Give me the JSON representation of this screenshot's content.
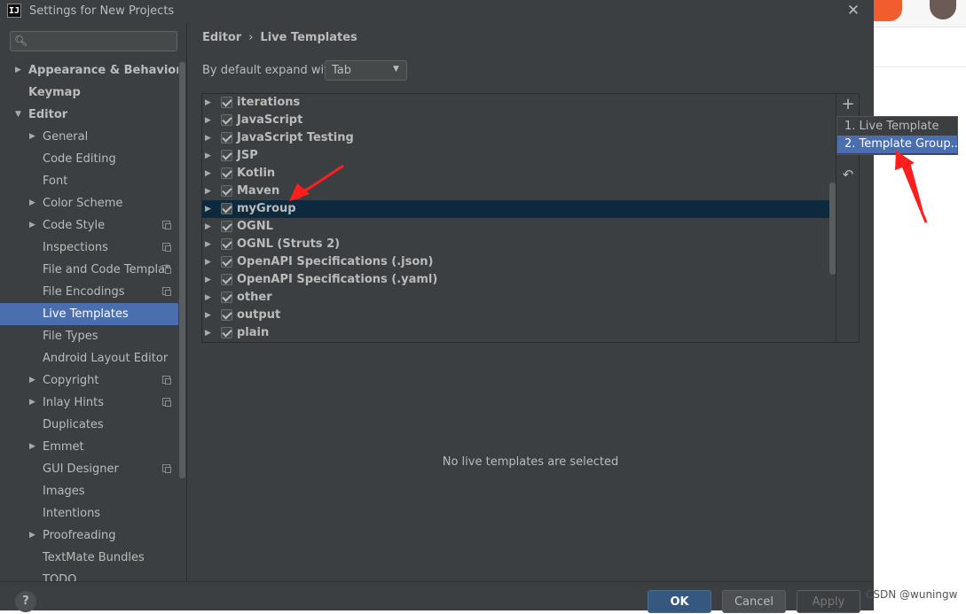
{
  "window": {
    "app_icon_label": "IJ",
    "title": "Settings for New Projects",
    "close_glyph": "✕"
  },
  "search": {
    "placeholder": "",
    "icon": "search-icon"
  },
  "sidebar": {
    "items": [
      {
        "label": "Appearance & Behavior",
        "level": 0,
        "expandable": true,
        "expanded": false,
        "bold": true
      },
      {
        "label": "Keymap",
        "level": 0,
        "expandable": false,
        "bold": true
      },
      {
        "label": "Editor",
        "level": 0,
        "expandable": true,
        "expanded": true,
        "bold": true
      },
      {
        "label": "General",
        "level": 1,
        "expandable": true,
        "expanded": false
      },
      {
        "label": "Code Editing",
        "level": 1
      },
      {
        "label": "Font",
        "level": 1
      },
      {
        "label": "Color Scheme",
        "level": 1,
        "expandable": true,
        "expanded": false
      },
      {
        "label": "Code Style",
        "level": 1,
        "expandable": true,
        "expanded": false,
        "project_icon": true
      },
      {
        "label": "Inspections",
        "level": 1,
        "project_icon": true
      },
      {
        "label": "File and Code Templat",
        "level": 1,
        "project_icon": true
      },
      {
        "label": "File Encodings",
        "level": 1,
        "project_icon": true
      },
      {
        "label": "Live Templates",
        "level": 1,
        "selected": true
      },
      {
        "label": "File Types",
        "level": 1
      },
      {
        "label": "Android Layout Editor",
        "level": 1
      },
      {
        "label": "Copyright",
        "level": 1,
        "expandable": true,
        "expanded": false,
        "project_icon": true
      },
      {
        "label": "Inlay Hints",
        "level": 1,
        "expandable": true,
        "expanded": false,
        "project_icon": true
      },
      {
        "label": "Duplicates",
        "level": 1
      },
      {
        "label": "Emmet",
        "level": 1,
        "expandable": true,
        "expanded": false
      },
      {
        "label": "GUI Designer",
        "level": 1,
        "project_icon": true
      },
      {
        "label": "Images",
        "level": 1
      },
      {
        "label": "Intentions",
        "level": 1
      },
      {
        "label": "Proofreading",
        "level": 1,
        "expandable": true,
        "expanded": false
      },
      {
        "label": "TextMate Bundles",
        "level": 1
      },
      {
        "label": "TODO",
        "level": 1
      }
    ]
  },
  "breadcrumb": {
    "parent": "Editor",
    "separator": "›",
    "current": "Live Templates"
  },
  "expand": {
    "label": "By default expand with",
    "value": "Tab"
  },
  "templates": {
    "groups": [
      {
        "name": "iterations",
        "checked": true
      },
      {
        "name": "JavaScript",
        "checked": true
      },
      {
        "name": "JavaScript Testing",
        "checked": true
      },
      {
        "name": "JSP",
        "checked": true
      },
      {
        "name": "Kotlin",
        "checked": true
      },
      {
        "name": "Maven",
        "checked": true
      },
      {
        "name": "myGroup",
        "checked": true,
        "selected": true
      },
      {
        "name": "OGNL",
        "checked": true
      },
      {
        "name": "OGNL (Struts 2)",
        "checked": true
      },
      {
        "name": "OpenAPI Specifications (.json)",
        "checked": true
      },
      {
        "name": "OpenAPI Specifications (.yaml)",
        "checked": true
      },
      {
        "name": "other",
        "checked": true
      },
      {
        "name": "output",
        "checked": true
      },
      {
        "name": "plain",
        "checked": true
      }
    ],
    "empty_message": "No live templates are selected"
  },
  "toolbar": {
    "add_glyph": "+",
    "undo_glyph": "↶"
  },
  "add_menu": {
    "items": [
      {
        "label": "1. Live Template"
      },
      {
        "label": "2. Template Group...",
        "selected": true
      }
    ]
  },
  "footer": {
    "help_label": "?",
    "ok_label": "OK",
    "cancel_label": "Cancel",
    "apply_label": "Apply"
  },
  "watermark": "CSDN @wuningw",
  "colors": {
    "dialog_bg": "#3c3f41",
    "selection_blue": "#4b6eaf",
    "tree_selection": "#0d293e",
    "annotation_red": "#ff1e1e"
  }
}
